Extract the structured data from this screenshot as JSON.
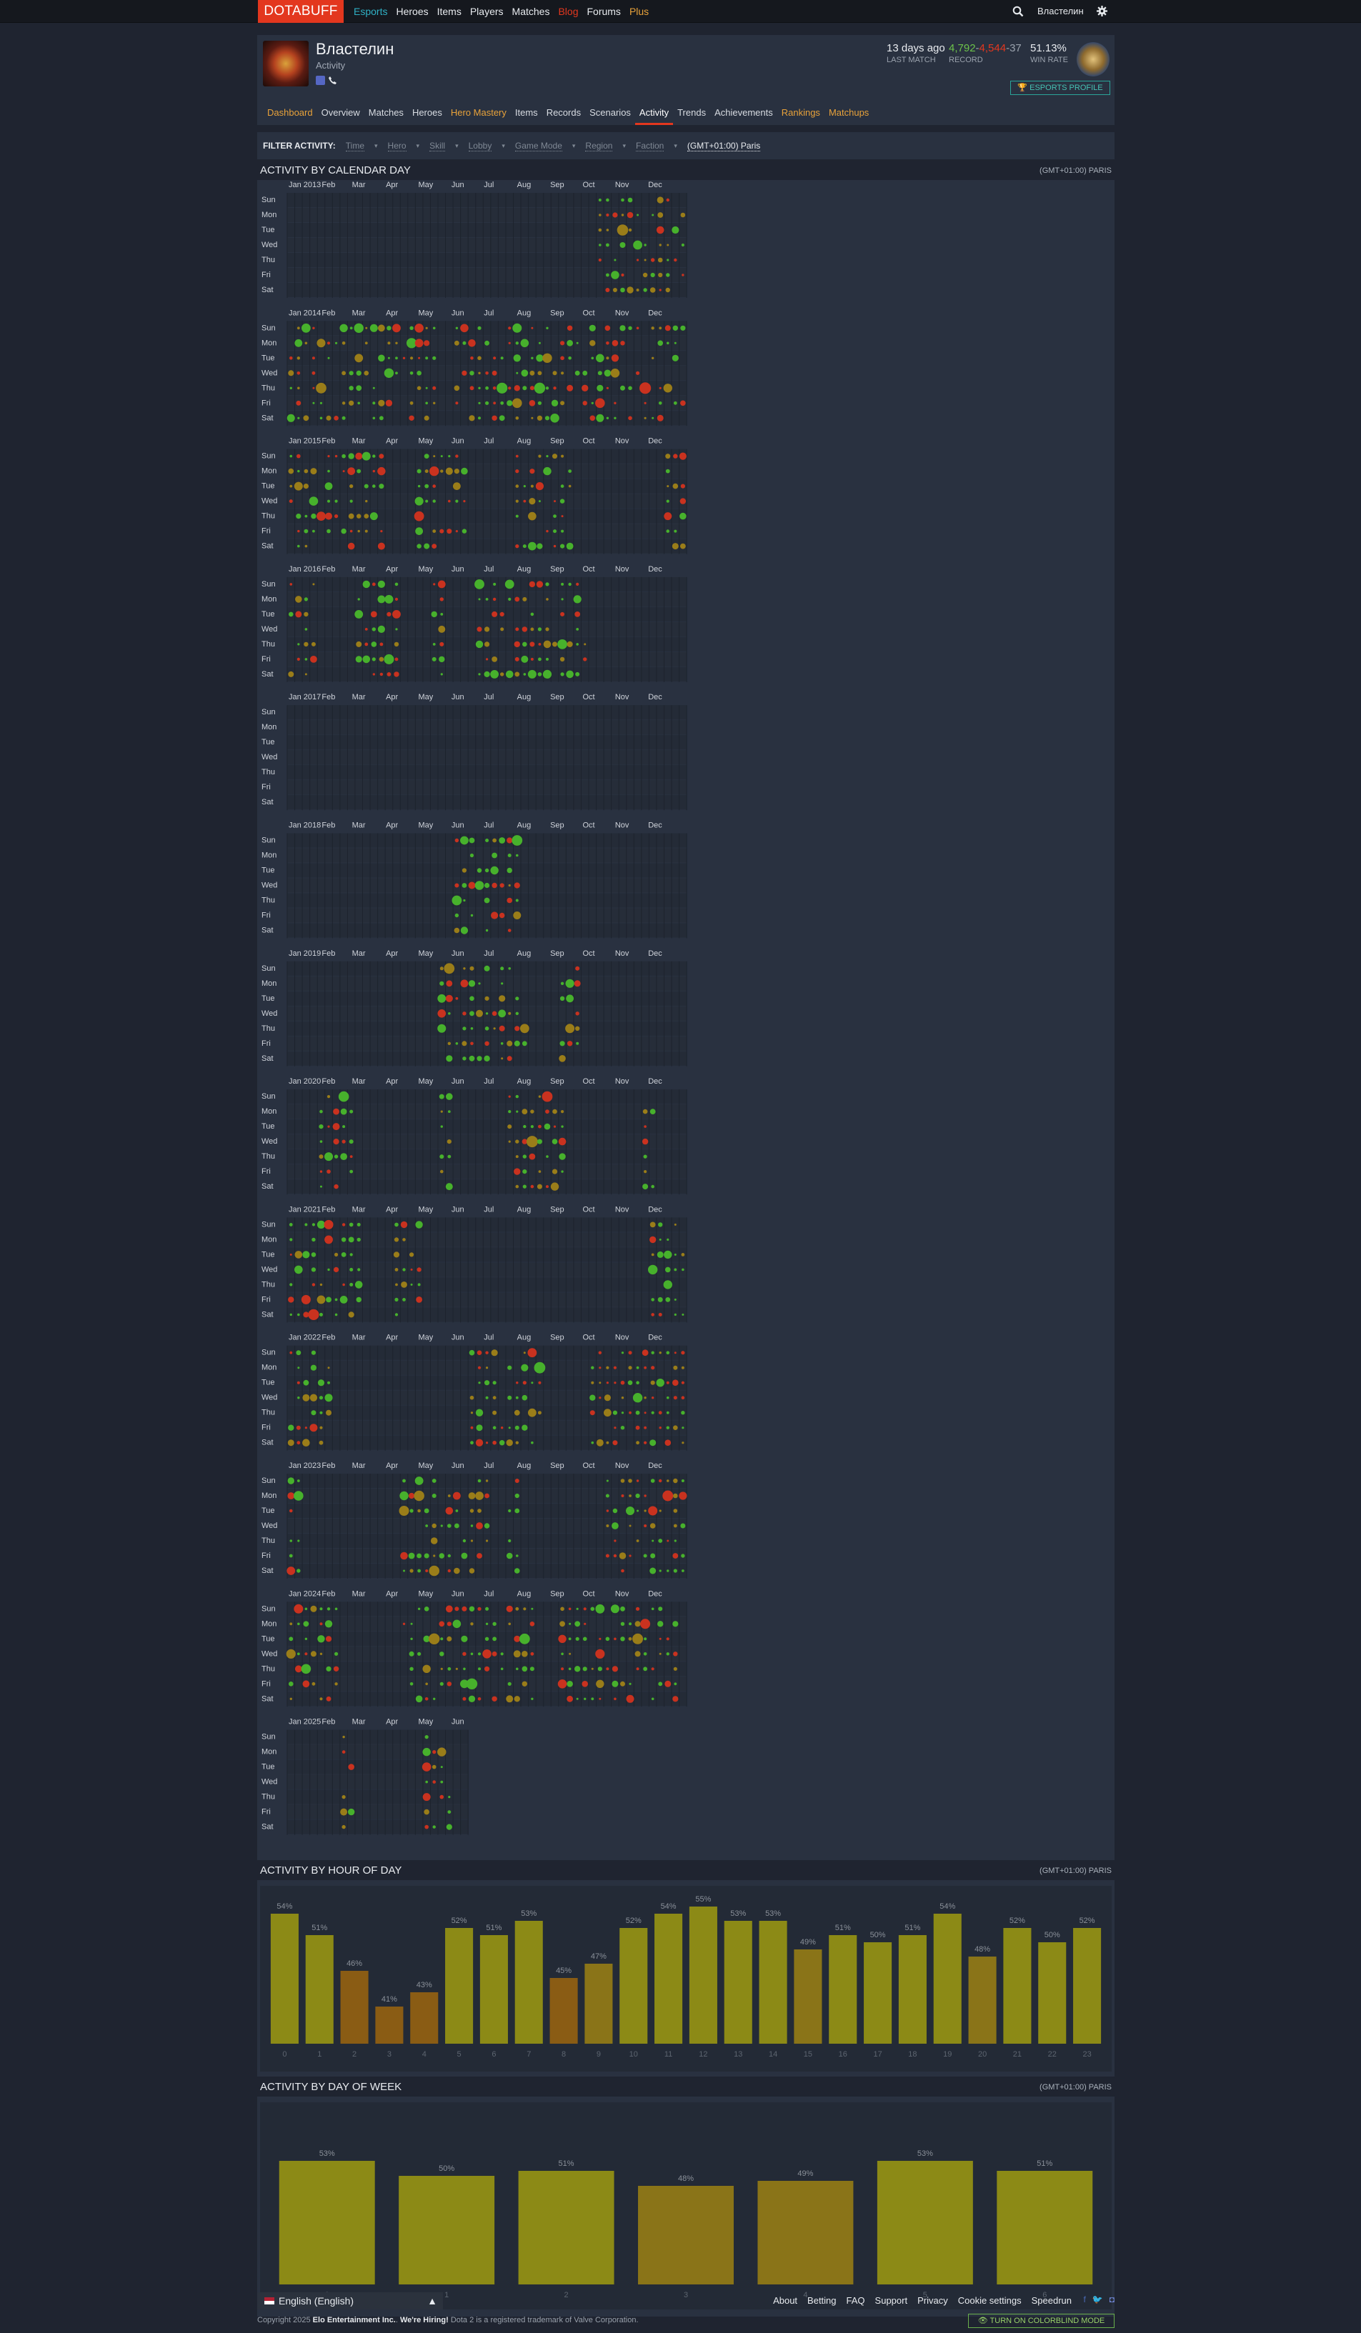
{
  "nav": {
    "logo": "DOTABUFF",
    "items": [
      {
        "label": "Esports",
        "color": "#2fb0c4"
      },
      {
        "label": "Heroes",
        "color": "#e8ebef"
      },
      {
        "label": "Items",
        "color": "#e8ebef"
      },
      {
        "label": "Players",
        "color": "#e8ebef"
      },
      {
        "label": "Matches",
        "color": "#e8ebef"
      },
      {
        "label": "Blog",
        "color": "#e3371e"
      },
      {
        "label": "Forums",
        "color": "#e8ebef"
      },
      {
        "label": "Plus",
        "color": "#e8a23a"
      }
    ],
    "user": "Властелин"
  },
  "profile": {
    "name": "Властелин",
    "subtitle": "Activity",
    "last_match": "13 days ago",
    "last_match_label": "LAST MATCH",
    "record_wins": "4,792",
    "record_losses": "4,544",
    "record_abandons": "37",
    "record_label": "RECORD",
    "win_rate": "51.13%",
    "win_rate_label": "WIN RATE",
    "esports_button": "ESPORTS PROFILE"
  },
  "tabs": [
    {
      "label": "Dashboard",
      "gold": true,
      "active": false
    },
    {
      "label": "Overview",
      "gold": false,
      "active": false
    },
    {
      "label": "Matches",
      "gold": false,
      "active": false
    },
    {
      "label": "Heroes",
      "gold": false,
      "active": false
    },
    {
      "label": "Hero Mastery",
      "gold": true,
      "active": false
    },
    {
      "label": "Items",
      "gold": false,
      "active": false
    },
    {
      "label": "Records",
      "gold": false,
      "active": false
    },
    {
      "label": "Scenarios",
      "gold": false,
      "active": false
    },
    {
      "label": "Activity",
      "gold": false,
      "active": true
    },
    {
      "label": "Trends",
      "gold": false,
      "active": false
    },
    {
      "label": "Achievements",
      "gold": false,
      "active": false
    },
    {
      "label": "Rankings",
      "gold": true,
      "active": false
    },
    {
      "label": "Matchups",
      "gold": true,
      "active": false
    }
  ],
  "filter": {
    "label": "FILTER ACTIVITY:",
    "items": [
      "Time",
      "Hero",
      "Skill",
      "Lobby",
      "Game Mode",
      "Region",
      "Faction"
    ],
    "timezone": "(GMT+01:00) Paris"
  },
  "calendar": {
    "title": "ACTIVITY BY CALENDAR DAY",
    "timezone": "(GMT+01:00) PARIS",
    "days": [
      "Sun",
      "Mon",
      "Tue",
      "Wed",
      "Thu",
      "Fri",
      "Sat"
    ],
    "months": [
      "Jan",
      "Feb",
      "Mar",
      "Apr",
      "May",
      "Jun",
      "Jul",
      "Aug",
      "Sep",
      "Oct",
      "Nov",
      "Dec"
    ],
    "years": [
      "2013",
      "2014",
      "2015",
      "2016",
      "2017",
      "2018",
      "2019",
      "2020",
      "2021",
      "2022",
      "2023",
      "2024",
      "2025"
    ]
  },
  "hour_chart": {
    "title": "ACTIVITY BY HOUR OF DAY",
    "timezone": "(GMT+01:00) PARIS",
    "chart_data": {
      "type": "bar",
      "categories": [
        "0",
        "1",
        "2",
        "3",
        "4",
        "5",
        "6",
        "7",
        "8",
        "9",
        "10",
        "11",
        "12",
        "13",
        "14",
        "15",
        "16",
        "17",
        "18",
        "19",
        "20",
        "21",
        "22",
        "23"
      ],
      "values": [
        54,
        51,
        46,
        41,
        43,
        52,
        51,
        53,
        45,
        47,
        52,
        54,
        55,
        53,
        53,
        49,
        51,
        50,
        51,
        54,
        48,
        52,
        50,
        52
      ],
      "labels": [
        "54%",
        "51%",
        "46%",
        "41%",
        "43%",
        "52%",
        "51%",
        "53%",
        "45%",
        "47%",
        "52%",
        "54%",
        "55%",
        "53%",
        "53%",
        "49%",
        "51%",
        "50%",
        "51%",
        "54%",
        "48%",
        "52%",
        "50%",
        "52%"
      ]
    }
  },
  "week_chart": {
    "title": "ACTIVITY BY DAY OF WEEK",
    "timezone": "(GMT+01:00) PARIS",
    "chart_data": {
      "type": "bar",
      "categories": [
        "0",
        "1",
        "2",
        "3",
        "4",
        "5",
        "6"
      ],
      "values": [
        53,
        50,
        51,
        48,
        49,
        53,
        51
      ],
      "labels": [
        "53%",
        "50%",
        "51%",
        "48%",
        "49%",
        "53%",
        "51%"
      ]
    }
  },
  "footer": {
    "language": "English (English)",
    "links": [
      "About",
      "Betting",
      "FAQ",
      "Support",
      "Privacy",
      "Cookie settings",
      "Speedrun"
    ],
    "copyright_pre": "Copyright 2025",
    "company": "Elo Entertainment Inc.",
    "hiring": "We're Hiring!",
    "copyright_post": "Dota 2 is a registered trademark of Valve Corporation.",
    "colorblind": "TURN ON COLORBLIND MODE"
  },
  "colors": {
    "accent": "#e3371e",
    "win": "#47b12c",
    "loss": "#c9321f",
    "bar": "#8c8a16"
  }
}
